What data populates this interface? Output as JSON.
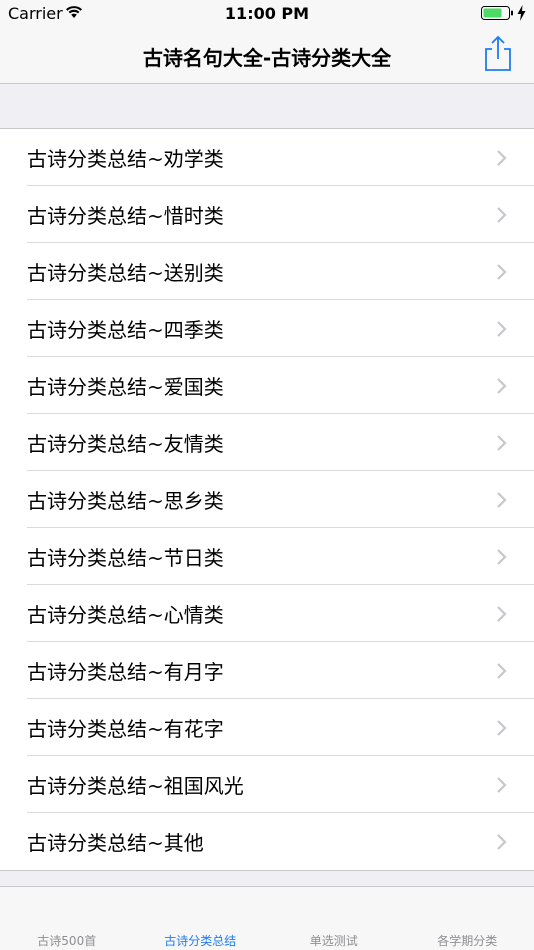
{
  "status_bar": {
    "carrier": "Carrier",
    "time": "11:00 PM"
  },
  "nav": {
    "title": "古诗名句大全-古诗分类大全",
    "share_icon": "share-icon"
  },
  "list": {
    "items": [
      {
        "label": "古诗分类总结~劝学类"
      },
      {
        "label": "古诗分类总结~惜时类"
      },
      {
        "label": "古诗分类总结~送别类"
      },
      {
        "label": "古诗分类总结~四季类"
      },
      {
        "label": "古诗分类总结~爱国类"
      },
      {
        "label": "古诗分类总结~友情类"
      },
      {
        "label": "古诗分类总结~思乡类"
      },
      {
        "label": "古诗分类总结~节日类"
      },
      {
        "label": "古诗分类总结~心情类"
      },
      {
        "label": "古诗分类总结~有月字"
      },
      {
        "label": "古诗分类总结~有花字"
      },
      {
        "label": "古诗分类总结~祖国风光"
      },
      {
        "label": "古诗分类总结~其他"
      }
    ]
  },
  "tab_bar": {
    "tabs": [
      {
        "label": "古诗500首"
      },
      {
        "label": "古诗分类总结"
      },
      {
        "label": "单选测试"
      },
      {
        "label": "各学期分类"
      }
    ],
    "active_index": 1
  },
  "colors": {
    "accent": "#1e7cf2",
    "battery": "#4cd964",
    "background": "#efeff4",
    "chevron": "#c7c7cc"
  }
}
